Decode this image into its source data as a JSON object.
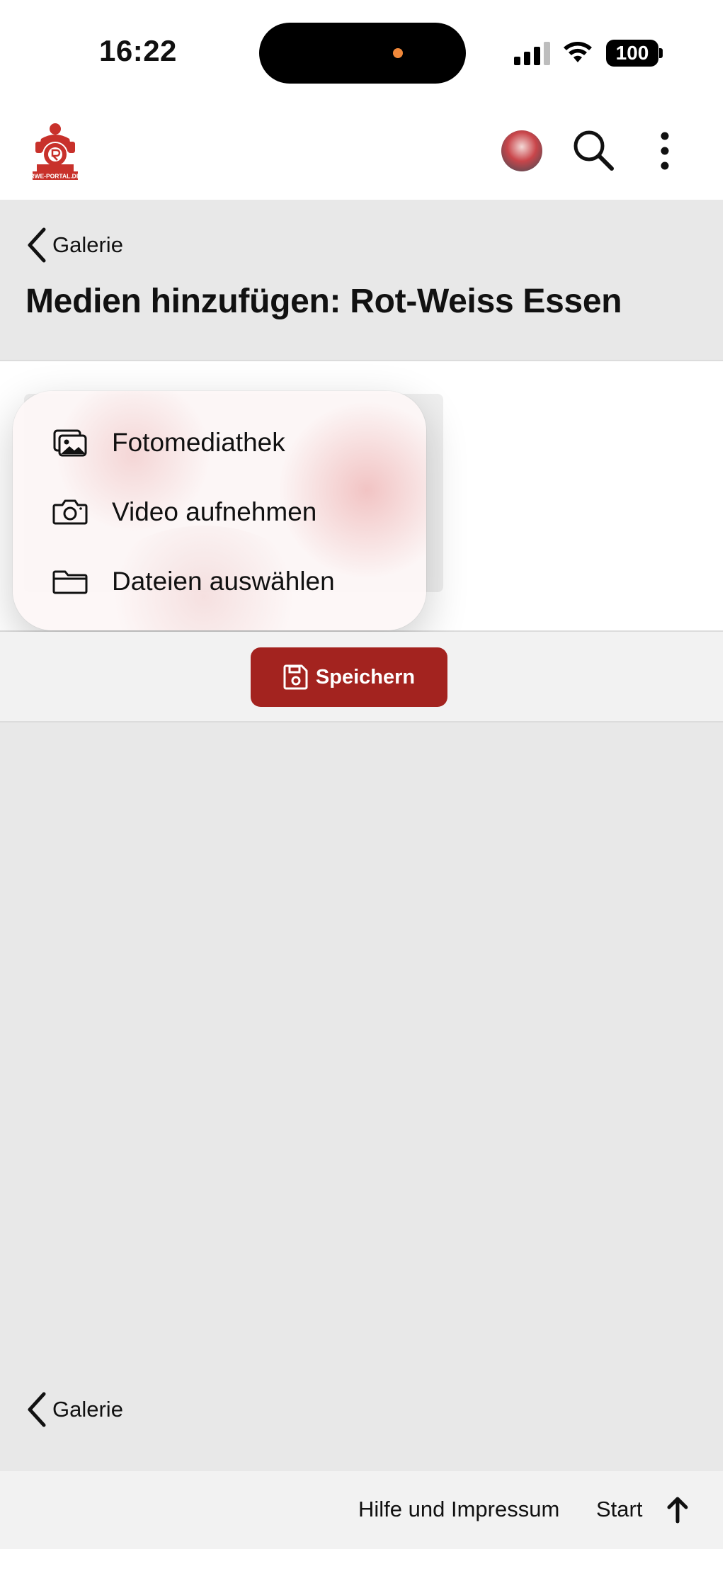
{
  "status_bar": {
    "time": "16:22",
    "battery": "100"
  },
  "header": {
    "logo_icon": "rwe-portal-logo",
    "logo_text": "RWE-PORTAL.DE",
    "avatar": "user-avatar",
    "search_icon": "search-icon",
    "more_icon": "more-vertical-icon"
  },
  "breadcrumb": {
    "back_label": "Galerie"
  },
  "page": {
    "title": "Medien hinzufügen: Rot-Weiss Essen"
  },
  "popup_menu": {
    "items": [
      {
        "label": "Fotomediathek",
        "icon": "photo-library-icon"
      },
      {
        "label": "Video aufnehmen",
        "icon": "camera-icon"
      },
      {
        "label": "Dateien auswählen",
        "icon": "folder-icon"
      }
    ]
  },
  "actions": {
    "save_label": "Speichern",
    "save_icon": "save-icon"
  },
  "bottom_breadcrumb": {
    "back_label": "Galerie"
  },
  "footer": {
    "help_label": "Hilfe und Impressum",
    "start_label": "Start",
    "up_icon": "arrow-up-icon"
  },
  "colors": {
    "accent": "#a3231f",
    "page_bg": "#e8e8e8",
    "header_bg": "#ffffff"
  }
}
